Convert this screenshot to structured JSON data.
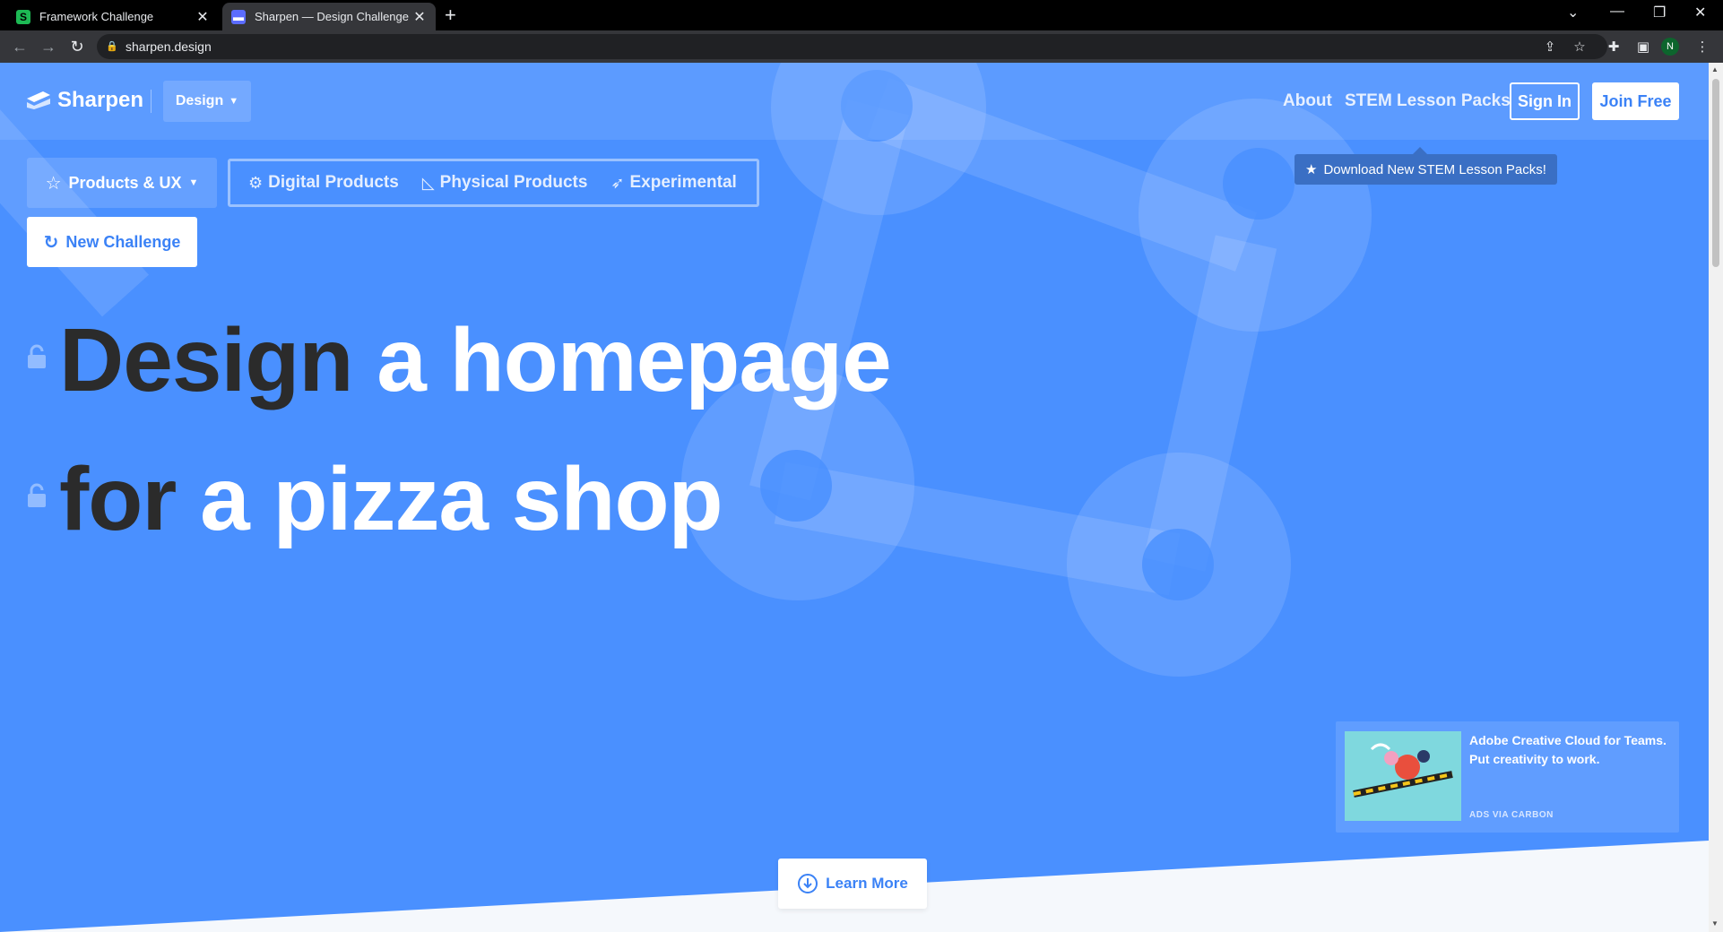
{
  "browser": {
    "tabs": [
      {
        "title": "Framework Challenge",
        "favicon": "S",
        "active": false
      },
      {
        "title": "Sharpen — Design Challenge Ge",
        "favicon": "",
        "active": true
      }
    ],
    "new_tab_icon": "+",
    "url": "sharpen.design",
    "profile_initial": "N"
  },
  "page": {
    "logo_text": "Sharpen",
    "design_dropdown": "Design",
    "nav": {
      "about": "About",
      "stem": "STEM Lesson Packs",
      "sign_in": "Sign In",
      "join_free": "Join Free"
    },
    "tooltip": "Download New STEM Lesson Packs!",
    "category_dropdown": "Products & UX",
    "category_tabs": [
      "Digital Products",
      "Physical Products",
      "Experimental"
    ],
    "new_challenge": "New Challenge",
    "headline": {
      "line1_a": "Design",
      "line1_b": "a homepage",
      "line2_a": "for",
      "line2_b": "a pizza shop"
    },
    "ad": {
      "text": "Adobe Creative Cloud for Teams. Put creativity to work.",
      "via": "ADS VIA CARBON"
    },
    "learn_more": "Learn More"
  },
  "colors": {
    "page_bg": "#4a90ff",
    "accent": "#3b82f6",
    "dark_word": "#2b2b2b",
    "tooltip_bg": "#3a6fc4"
  }
}
